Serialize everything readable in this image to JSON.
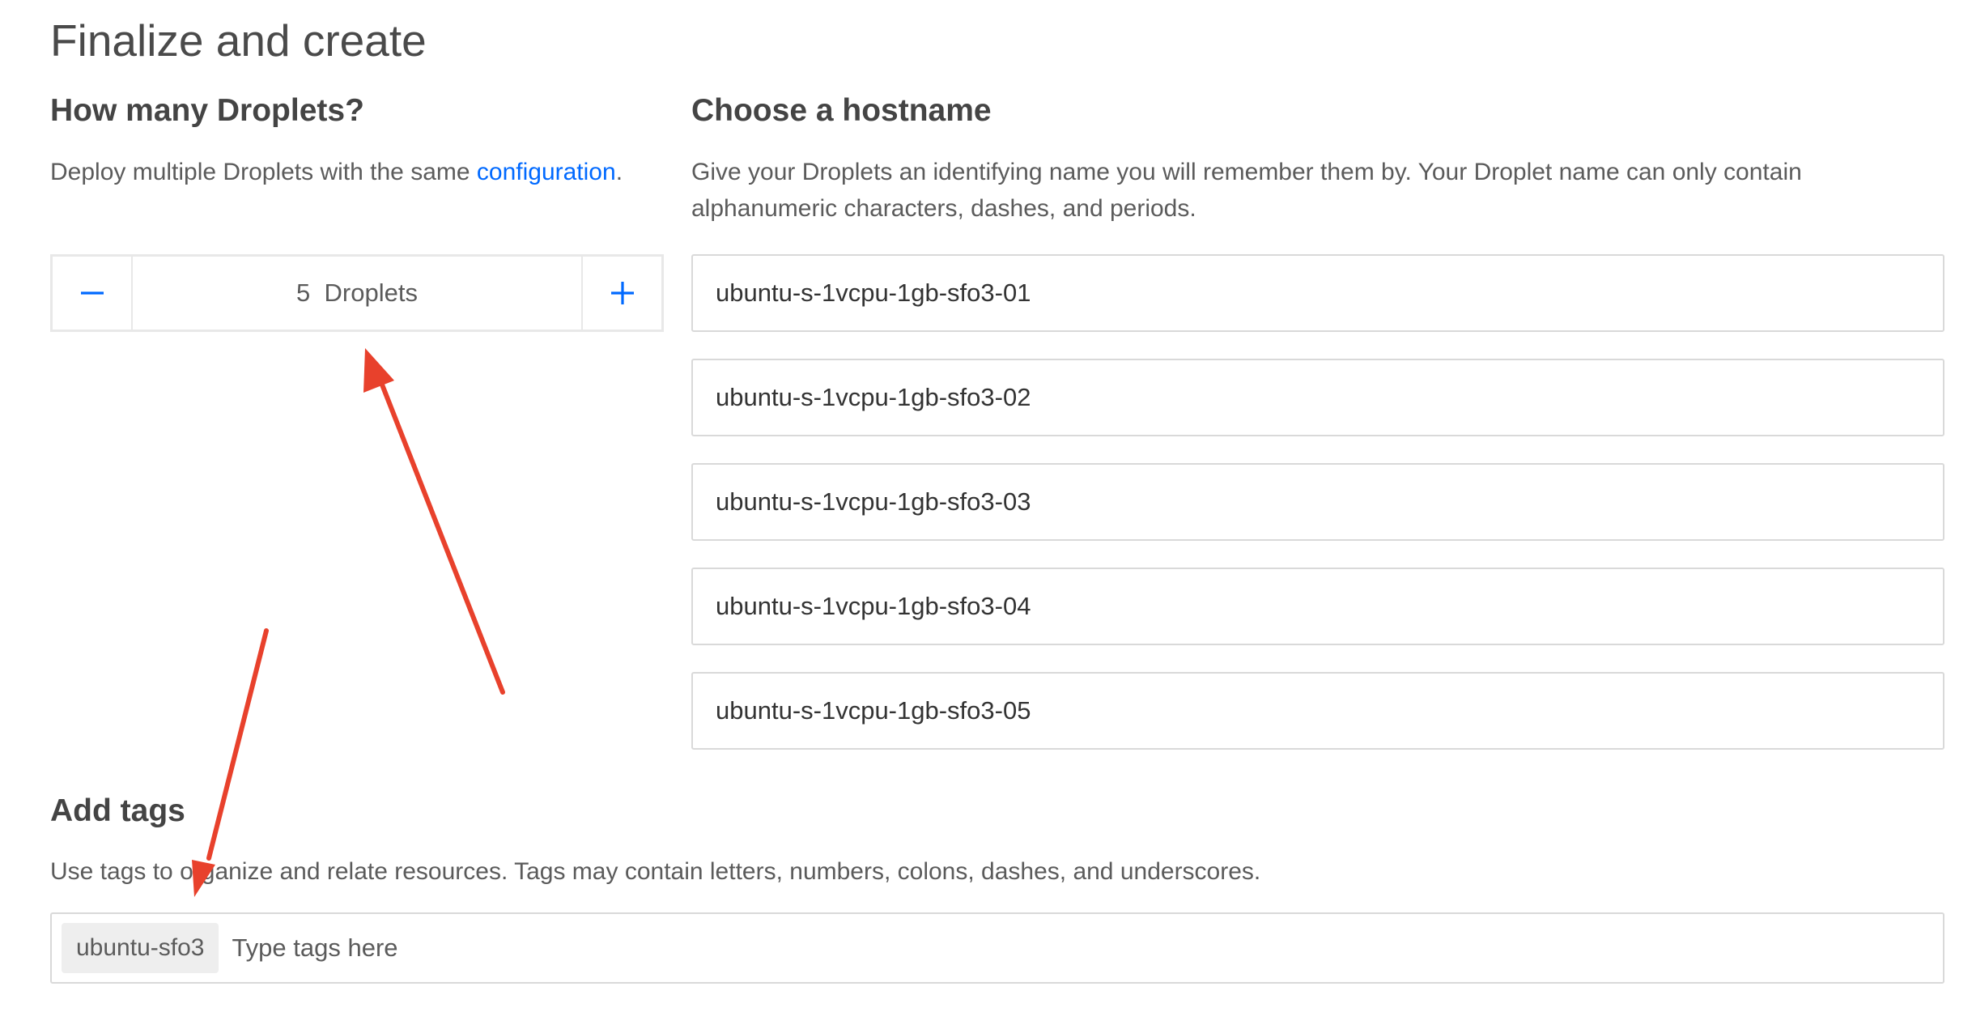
{
  "page": {
    "title": "Finalize and create"
  },
  "droplets": {
    "heading": "How many Droplets?",
    "description_prefix": "Deploy multiple Droplets with the same ",
    "description_link": "configuration",
    "description_suffix": ".",
    "count": "5",
    "count_unit": "Droplets",
    "minus_icon": "minus-icon",
    "plus_icon": "plus-icon"
  },
  "hostname": {
    "heading": "Choose a hostname",
    "description": "Give your Droplets an identifying name you will remember them by. Your Droplet name can only contain alphanumeric characters, dashes, and periods.",
    "values": [
      "ubuntu-s-1vcpu-1gb-sfo3-01",
      "ubuntu-s-1vcpu-1gb-sfo3-02",
      "ubuntu-s-1vcpu-1gb-sfo3-03",
      "ubuntu-s-1vcpu-1gb-sfo3-04",
      "ubuntu-s-1vcpu-1gb-sfo3-05"
    ]
  },
  "tags": {
    "heading": "Add tags",
    "description": "Use tags to organize and relate resources. Tags may contain letters, numbers, colons, dashes, and underscores.",
    "chips": [
      "ubuntu-sfo3"
    ],
    "placeholder": "Type tags here"
  },
  "colors": {
    "accent": "#0069ff",
    "annotation_arrow": "#e8412c",
    "border": "#d9d9d9",
    "chip_bg": "#eeeeee"
  }
}
